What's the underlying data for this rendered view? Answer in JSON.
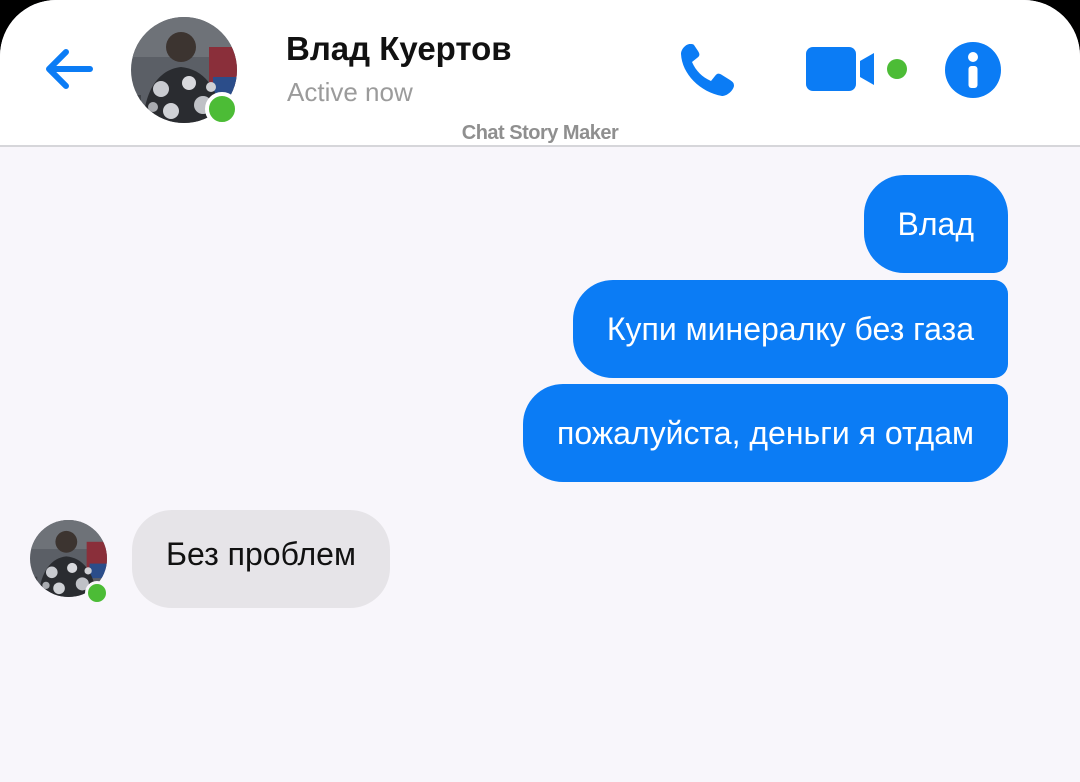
{
  "header": {
    "contact_name": "Влад Куертов",
    "status": "Active now",
    "watermark": "Chat Story Maker",
    "icons": {
      "back": "back-arrow-icon",
      "call": "phone-icon",
      "video": "video-camera-icon",
      "info": "info-icon"
    }
  },
  "messages": [
    {
      "side": "outgoing",
      "text": "Влад"
    },
    {
      "side": "outgoing",
      "text": "Купи минералку без газа"
    },
    {
      "side": "outgoing",
      "text": "пожалуйста, деньги я отдам"
    },
    {
      "side": "incoming",
      "text": "Без проблем"
    }
  ],
  "colors": {
    "accent": "#0b7cf5",
    "online": "#4cbc36",
    "incoming_bubble": "#e6e4e8",
    "background": "#f8f6fb"
  }
}
